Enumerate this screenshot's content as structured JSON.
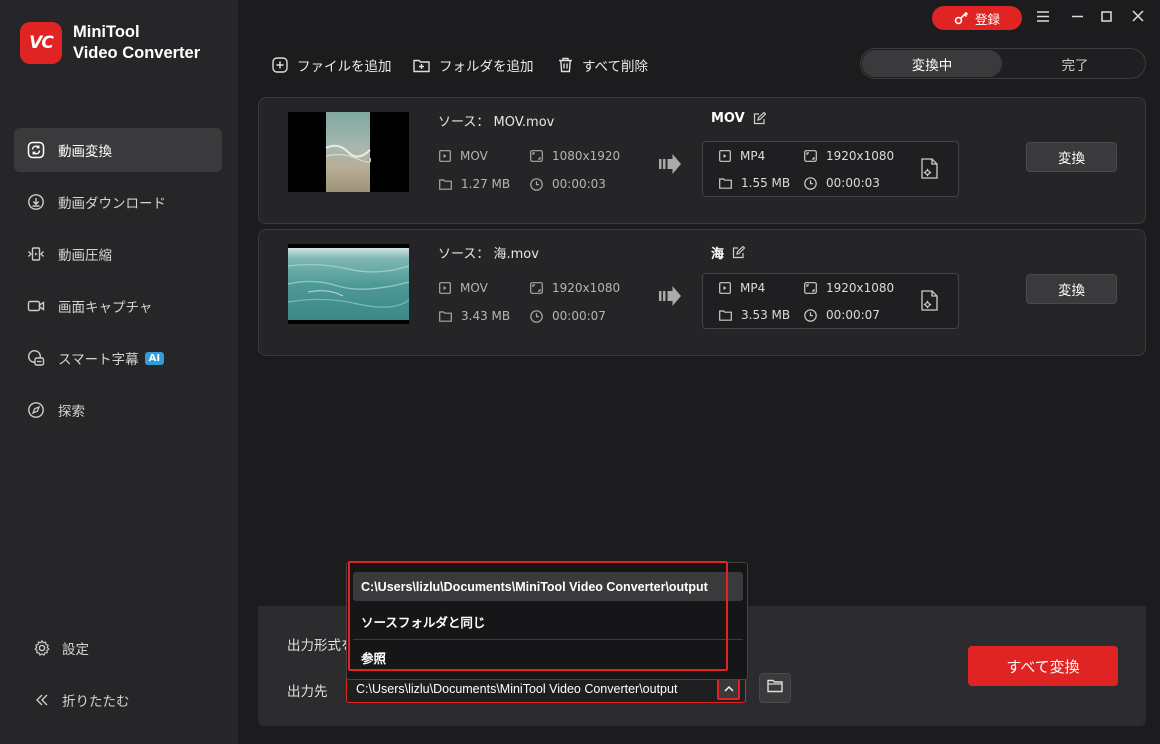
{
  "app": {
    "name_line1": "MiniTool",
    "name_line2": "Video Converter",
    "logo_text": "VC",
    "accent": "#e02424"
  },
  "titlebar": {
    "register_label": "登録"
  },
  "sidebar": {
    "items": [
      {
        "label": "動画変換",
        "icon": "convert-icon",
        "active": true
      },
      {
        "label": "動画ダウンロード",
        "icon": "download-icon"
      },
      {
        "label": "動画圧縮",
        "icon": "compress-icon"
      },
      {
        "label": "画面キャプチャ",
        "icon": "camera-icon"
      },
      {
        "label": "スマート字幕",
        "icon": "subtitle-icon",
        "badge": "AI"
      },
      {
        "label": "探索",
        "icon": "compass-icon"
      }
    ],
    "settings_label": "設定",
    "collapse_label": "折りたたむ"
  },
  "toolbar": {
    "add_file": "ファイルを追加",
    "add_folder": "フォルダを追加",
    "delete_all": "すべて削除"
  },
  "tabs": {
    "converting": "変換中",
    "done": "完了"
  },
  "files": [
    {
      "source": "ソース：  MOV.mov",
      "src_format": "MOV",
      "src_resolution": "1080x1920",
      "src_size": "1.27 MB",
      "src_duration": "00:00:03",
      "target_name": "MOV",
      "tgt_format": "MP4",
      "tgt_resolution": "1920x1080",
      "tgt_size": "1.55 MB",
      "tgt_duration": "00:00:03",
      "convert_label": "変換"
    },
    {
      "source": "ソース：  海.mov",
      "src_format": "MOV",
      "src_resolution": "1920x1080",
      "src_size": "3.43 MB",
      "src_duration": "00:00:07",
      "target_name": "海",
      "tgt_format": "MP4",
      "tgt_resolution": "1920x1080",
      "tgt_size": "3.53 MB",
      "tgt_duration": "00:00:07",
      "convert_label": "変換"
    }
  ],
  "bottom": {
    "output_format_label": "出力形式を",
    "output_dest_label": "出力先",
    "output_path": "C:\\Users\\lizlu\\Documents\\MiniTool Video Converter\\output",
    "convert_all": "すべて変換"
  },
  "dropdown": {
    "options": [
      "C:\\Users\\lizlu\\Documents\\MiniTool Video Converter\\output",
      "ソースフォルダと同じ",
      "参照"
    ]
  }
}
